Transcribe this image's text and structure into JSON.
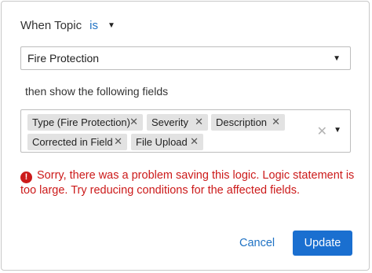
{
  "condition": {
    "label": "When Topic",
    "operator": "is",
    "operator_caret_icon": "caret-down-icon"
  },
  "topic_select": {
    "value": "Fire Protection",
    "caret_icon": "caret-down-icon"
  },
  "then_label": "then show the following fields",
  "fields": {
    "chips": [
      {
        "label": "Type (Fire Protection)",
        "remove": "✕"
      },
      {
        "label": "Severity",
        "remove": "✕"
      },
      {
        "label": "Description",
        "remove": "✕"
      },
      {
        "label": "Corrected in Field",
        "remove": "✕"
      },
      {
        "label": "File Upload",
        "remove": "✕"
      }
    ],
    "clear_all": "✕",
    "caret_icon": "caret-down-icon"
  },
  "error": {
    "icon": "!",
    "message": "Sorry, there was a problem saving this logic. Logic statement is too large. Try reducing conditions for the affected fields.",
    "color": "#cc1a1a"
  },
  "actions": {
    "cancel_label": "Cancel",
    "update_label": "Update",
    "accent_color": "#1a6fd0"
  }
}
